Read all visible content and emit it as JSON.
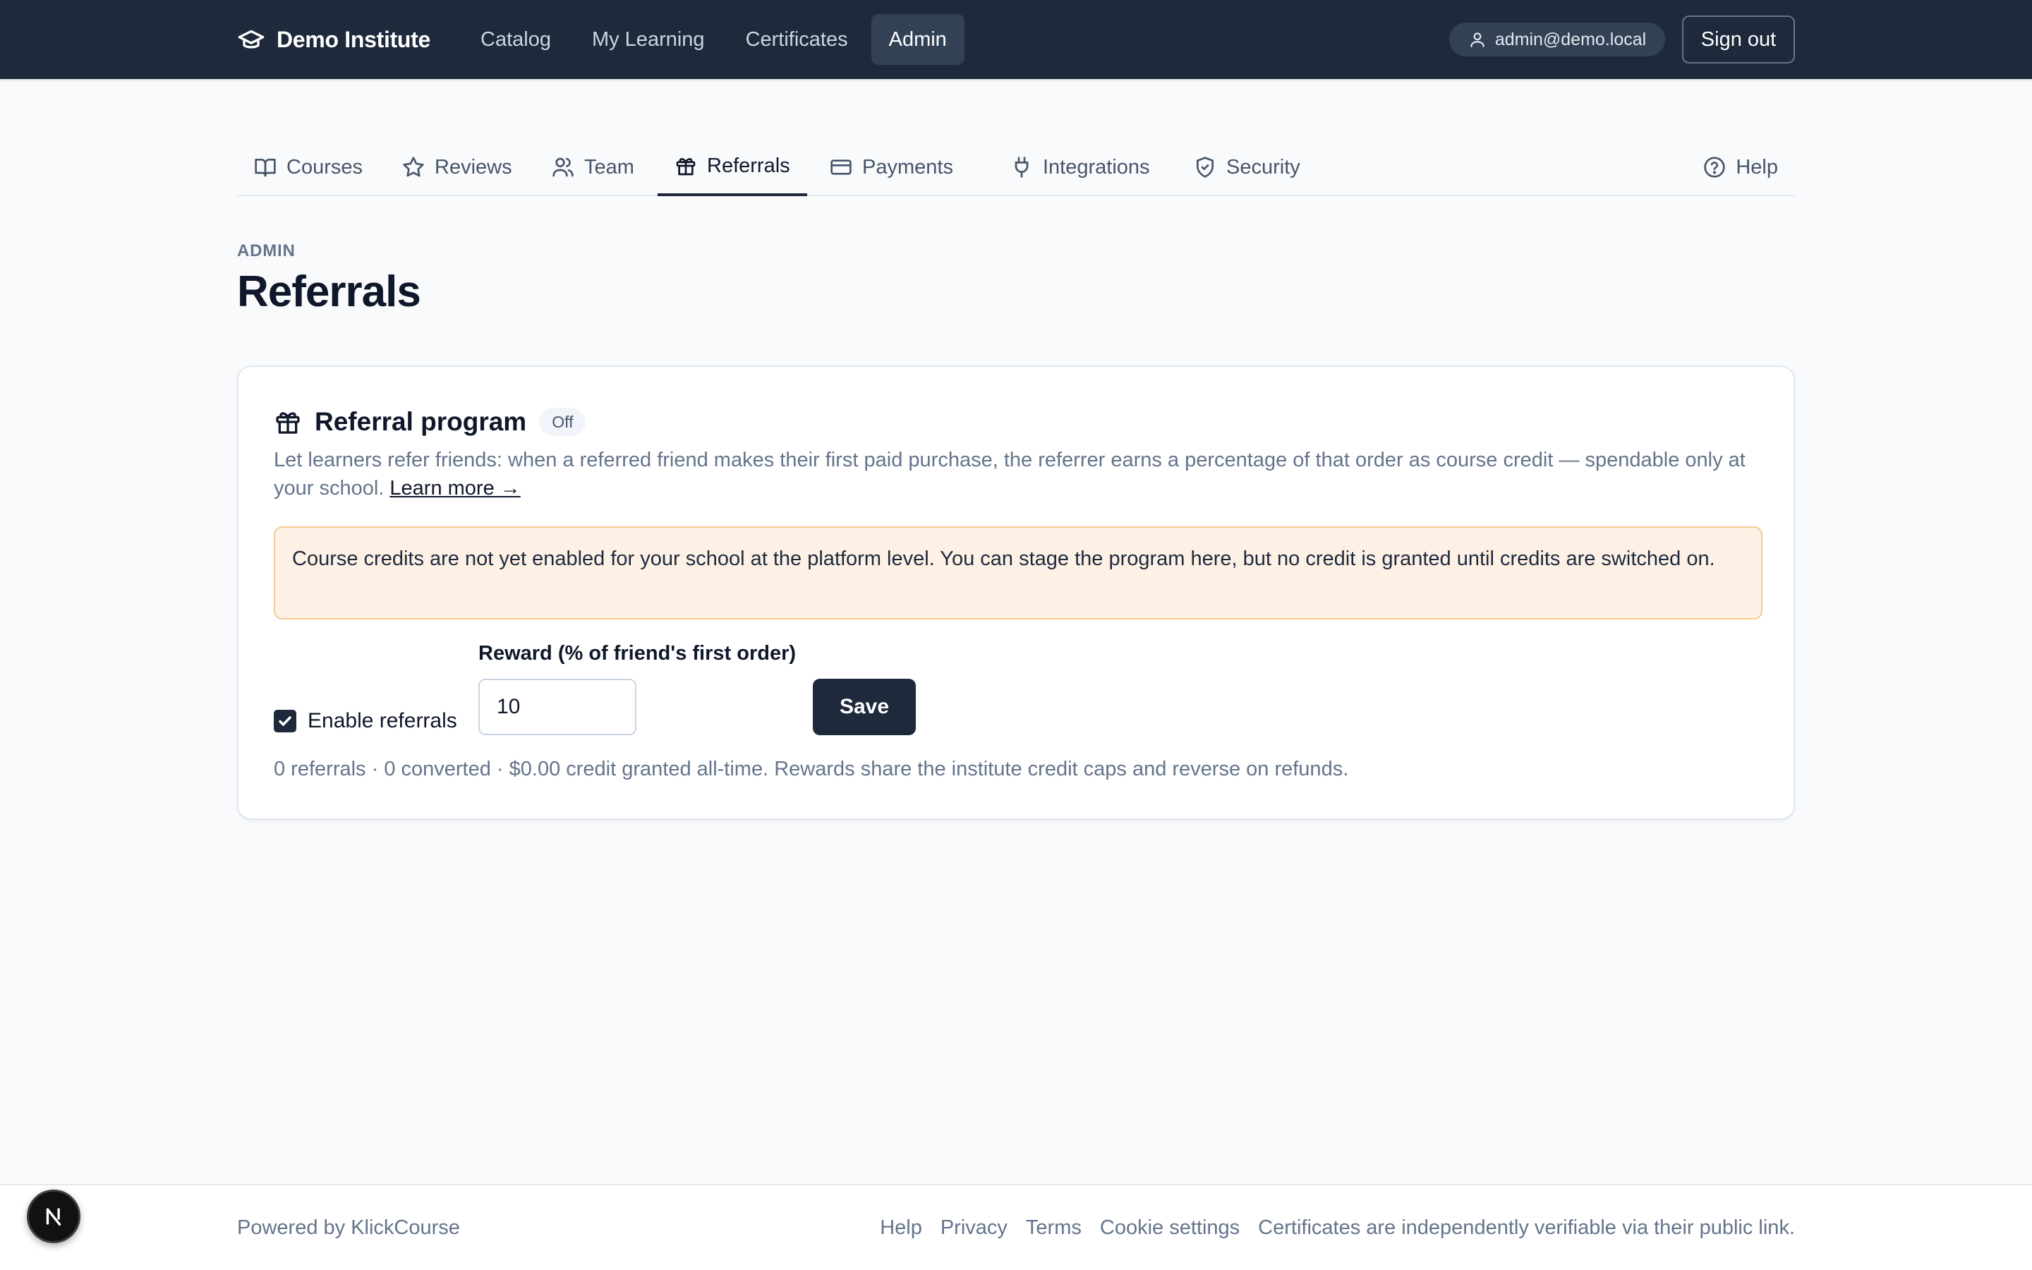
{
  "header": {
    "brand": "Demo Institute",
    "nav": [
      {
        "label": "Catalog",
        "active": false
      },
      {
        "label": "My Learning",
        "active": false
      },
      {
        "label": "Certificates",
        "active": false
      },
      {
        "label": "Admin",
        "active": true
      }
    ],
    "user_email": "admin@demo.local",
    "sign_out_label": "Sign out"
  },
  "admin_tabs": [
    {
      "label": "Courses",
      "icon": "book-icon"
    },
    {
      "label": "Reviews",
      "icon": "star-icon"
    },
    {
      "label": "Team",
      "icon": "users-icon"
    },
    {
      "label": "Referrals",
      "icon": "gift-icon",
      "active": true
    },
    {
      "label": "Payments",
      "icon": "credit-card-icon"
    },
    {
      "label": "Integrations",
      "icon": "plug-icon"
    },
    {
      "label": "Security",
      "icon": "shield-check-icon"
    }
  ],
  "help_label": "Help",
  "page": {
    "eyebrow": "ADMIN",
    "title": "Referrals"
  },
  "referral_card": {
    "title": "Referral program",
    "status_badge": "Off",
    "description": "Let learners refer friends: when a referred friend makes their first paid purchase, the referrer earns a percentage of that order as course credit — spendable only at your school.",
    "learn_more": "Learn more →",
    "warning": "Course credits are not yet enabled for your school at the platform level. You can stage the program here, but no credit is granted until credits are switched on.",
    "enable_label": "Enable referrals",
    "enabled": true,
    "reward_label": "Reward (% of friend's first order)",
    "reward_value": "10",
    "save_label": "Save",
    "stats": "0 referrals · 0 converted · $0.00 credit granted all-time. Rewards share the institute credit caps and reverse on refunds."
  },
  "footer": {
    "powered_by": "Powered by KlickCourse",
    "links": [
      "Help",
      "Privacy",
      "Terms",
      "Cookie settings"
    ],
    "note": "Certificates are independently verifiable via their public link."
  },
  "colors": {
    "nav_bg": "#1e293b",
    "accent": "#1e293b",
    "warning_bg": "#fdf1e6",
    "warning_border": "#f5c98f"
  }
}
